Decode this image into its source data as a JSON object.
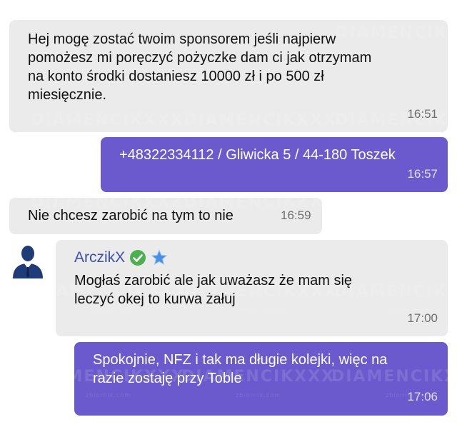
{
  "messages": [
    {
      "direction": "incoming",
      "text": "Hej mogę zostać twoim sponsorem jeśli najpierw\npomożesz mi poręczyć pożyczke dam ci jak otrzymam\nna konto środki dostaniesz 10000 zł i po 500 zł\nmiesięcznie.",
      "time": "16:51"
    },
    {
      "direction": "outgoing",
      "text": "+48322334112 / Gliwicka 5 / 44-180 Toszek",
      "time": "16:57"
    },
    {
      "direction": "incoming",
      "text": "Nie chcesz zarobić na tym to nie",
      "time": "16:59"
    },
    {
      "direction": "incoming",
      "sender": "ArczikX",
      "sender_badges": [
        "verified-check-icon",
        "star-icon"
      ],
      "text": "Mogłaś zarobić ale jak uważasz że mam się\nleczyć okej to kurwa żałuj",
      "time": "17:00"
    },
    {
      "direction": "outgoing",
      "text": "Spokojnie, NFZ i tak ma długie kolejki, więc na\nrazie zostaję przy Toble",
      "time": "17:06"
    }
  ],
  "watermark": {
    "main": "DIAMENCIKXXX",
    "sub": "zbiornik.com"
  },
  "colors": {
    "incoming_bg": "#ebebeb",
    "outgoing_bg": "#6a5acd",
    "sender_name": "#3b50a8",
    "verified_badge": "#4caf50",
    "star_badge": "#4a90e2",
    "avatar_suit": "#1f3c78"
  }
}
